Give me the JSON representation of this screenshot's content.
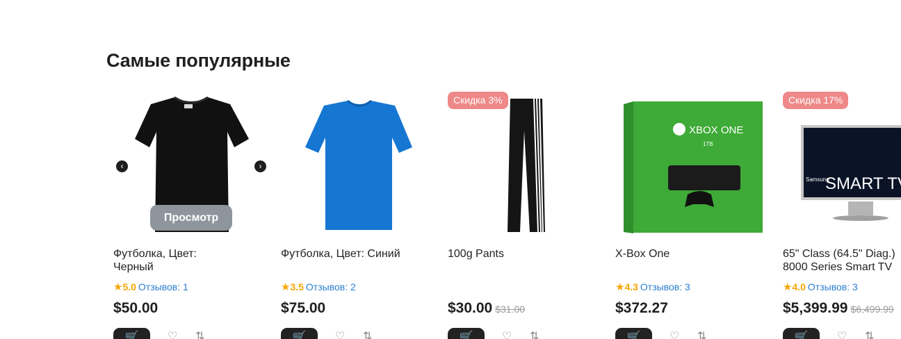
{
  "section": {
    "title": "Самые популярные"
  },
  "product_card": {
    "view_label": "Просмотр"
  },
  "icons": {
    "star": "star-icon",
    "cart": "cart-icon",
    "wishlist": "heart-icon",
    "compare": "compare-icon",
    "prev": "chevron-left-icon",
    "next": "chevron-right-icon"
  },
  "colors": {
    "badge": "#ef8888",
    "star": "#f7a600",
    "link": "#2b7fd0",
    "dark": "#222222"
  },
  "products": [
    {
      "name": "Футболка, Цвет: Черный",
      "rating": "5.0",
      "reviews": "Отзывов: 1",
      "price": "$50.00",
      "old_price": "",
      "badge": ""
    },
    {
      "name": "Футболка, Цвет: Синий",
      "rating": "3.5",
      "reviews": "Отзывов: 2",
      "price": "$75.00",
      "old_price": "",
      "badge": ""
    },
    {
      "name": "100g Pants",
      "rating": "",
      "reviews": "",
      "price": "$30.00",
      "old_price": "$31.00",
      "badge": "Скидка 3%"
    },
    {
      "name": "X-Box One",
      "rating": "4.3",
      "reviews": "Отзывов: 3",
      "price": "$372.27",
      "old_price": "",
      "badge": ""
    },
    {
      "name": "65\" Class (64.5\" Diag.)\n8000 Series Smart TV",
      "rating": "4.0",
      "reviews": "Отзывов: 3",
      "price": "$5,399.99",
      "old_price": "$6,499.99",
      "badge": "Скидка 17%"
    }
  ],
  "images": {
    "xbox_logo": "XBOX ONE",
    "xbox_capacity": "1TB",
    "tv_brand": "Samsung",
    "tv_logo": "SMART TV"
  }
}
